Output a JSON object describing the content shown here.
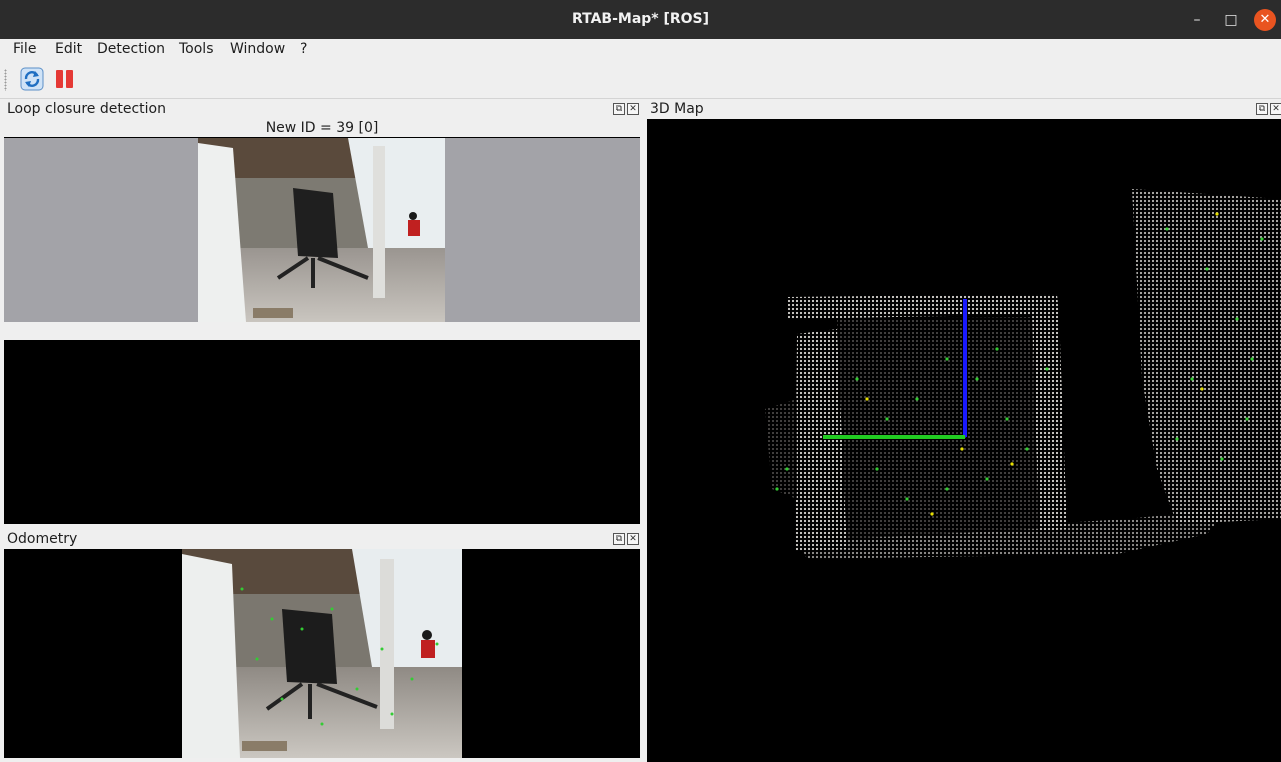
{
  "window": {
    "title": "RTAB-Map* [ROS]"
  },
  "menu": [
    "File",
    "Edit",
    "Detection",
    "Tools",
    "Window",
    "?"
  ],
  "toolbar": {
    "buttons": [
      "refresh-icon",
      "pause-icon"
    ]
  },
  "docks": {
    "loop_closure": {
      "title": "Loop closure detection",
      "status": "New ID = 39 [0]"
    },
    "odometry": {
      "title": "Odometry"
    },
    "map3d": {
      "title": "3D Map"
    }
  },
  "colors": {
    "titlebar": "#2c2c2c",
    "close_button": "#e95420",
    "pause_red": "#e53935",
    "axis_blue": "#1a1aff",
    "axis_green": "#22cc22",
    "feature_green": "#33cc33",
    "feature_yellow": "#e8e000"
  }
}
